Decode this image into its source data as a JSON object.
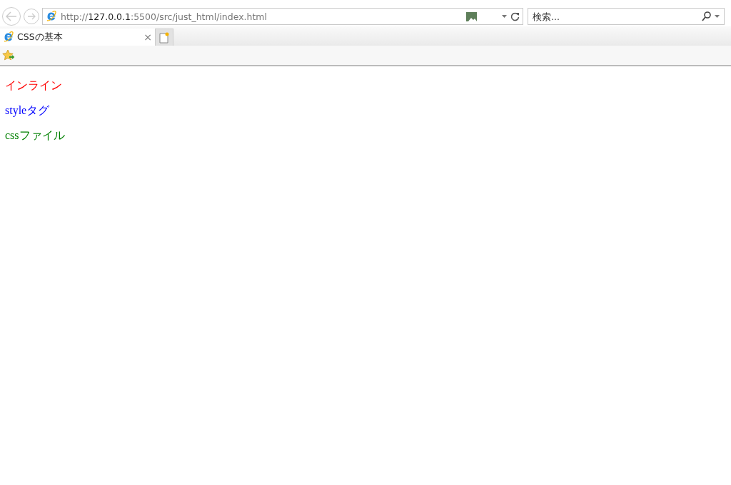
{
  "address_bar": {
    "url": "http://**127.0.0.1**:5500/src/just_html/index.html"
  },
  "search": {
    "placeholder": "検索..."
  },
  "tabs": [
    {
      "label": "CSSの基本",
      "selected": true,
      "close": "×"
    }
  ],
  "paragraphs": [
    {
      "text": "インライン",
      "color": "#ff0000"
    },
    {
      "text": "styleタグ",
      "color": "#0000ff"
    },
    {
      "text": "cssファイル",
      "color": "#008000"
    }
  ]
}
